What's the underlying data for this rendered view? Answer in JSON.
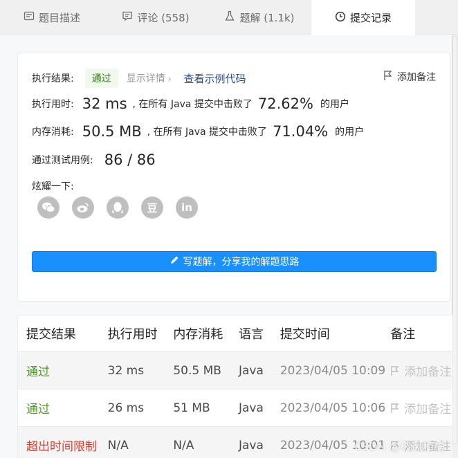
{
  "tabs": [
    {
      "label": "题目描述",
      "icon": "description-icon"
    },
    {
      "label": "评论 (558)",
      "icon": "comment-icon"
    },
    {
      "label": "题解 (1.1k)",
      "icon": "flask-icon"
    },
    {
      "label": "提交记录",
      "icon": "clock-icon"
    }
  ],
  "result": {
    "status_label": "执行结果:",
    "status_value": "通过",
    "detail_link": "显示详情",
    "example_link": "查看示例代码",
    "note_button": "添加备注",
    "runtime_label": "执行用时:",
    "runtime_value": "32 ms",
    "runtime_mid": ", 在所有 Java 提交中击败了",
    "runtime_percent": "72.62%",
    "runtime_suffix": "的用户",
    "memory_label": "内存消耗:",
    "memory_value": "50.5 MB",
    "memory_mid": ", 在所有 Java 提交中击败了",
    "memory_percent": "71.04%",
    "memory_suffix": "的用户",
    "tests_label": "通过测试用例:",
    "tests_value": "86 / 86",
    "share_label": "炫耀一下:",
    "share_icons": [
      "wechat-icon",
      "weibo-icon",
      "qq-icon",
      "douban-icon",
      "linkedin-icon"
    ],
    "douban_glyph": "豆",
    "linkedin_glyph": "in",
    "write_button": "写题解，分享我的解题思路"
  },
  "table": {
    "headers": [
      "提交结果",
      "执行用时",
      "内存消耗",
      "语言",
      "提交时间",
      "备注"
    ],
    "rows": [
      {
        "status": "通过",
        "time": "32 ms",
        "memory": "50.5 MB",
        "lang": "Java",
        "submitted": "2023/04/05 10:09",
        "note": "添加备注"
      },
      {
        "status": "通过",
        "time": "26 ms",
        "memory": "51 MB",
        "lang": "Java",
        "submitted": "2023/04/05 10:06",
        "note": "添加备注"
      },
      {
        "status": "超出时间限制",
        "time": "N/A",
        "memory": "N/A",
        "lang": "Java",
        "submitted": "2023/04/05 10:01",
        "note": "添加备注"
      }
    ]
  },
  "watermark": "CSDN @破风和橘",
  "colors": {
    "accent": "#1a90ff",
    "pass": "#4a9f20",
    "fail": "#e03c2e"
  }
}
